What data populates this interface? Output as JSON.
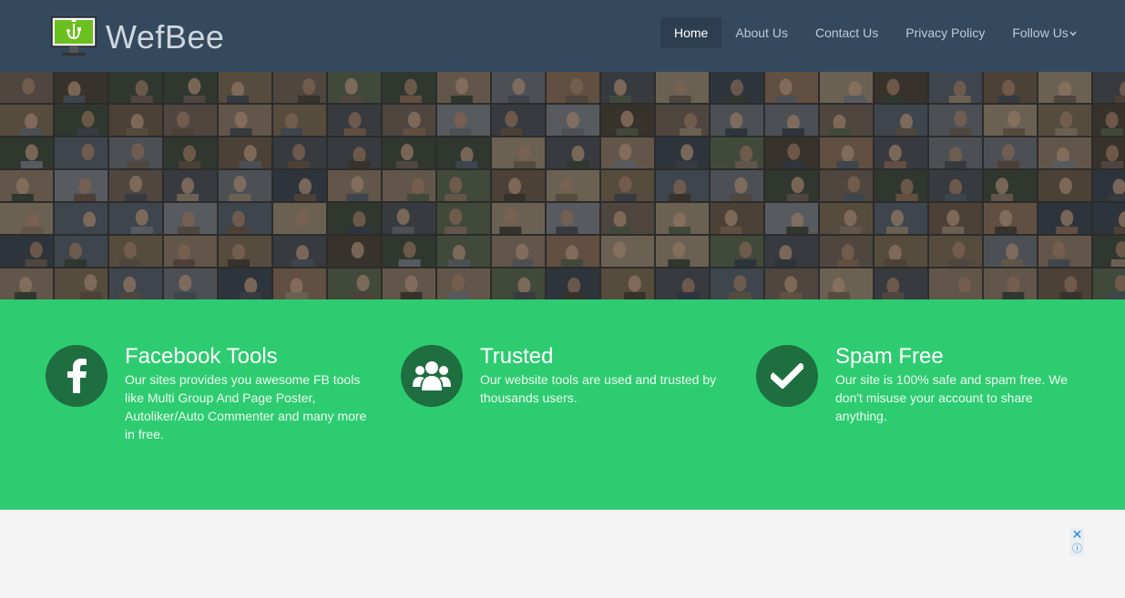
{
  "brand": {
    "name": "WefBee",
    "logo_icon": "monitor-usb-logo"
  },
  "nav": {
    "items": [
      {
        "label": "Home",
        "active": true
      },
      {
        "label": "About Us"
      },
      {
        "label": "Contact Us"
      },
      {
        "label": "Privacy Policy"
      },
      {
        "label": "Follow Us",
        "dropdown": true
      }
    ]
  },
  "hero": {
    "image": "profile-photo-collage"
  },
  "features": [
    {
      "icon": "facebook-f-icon",
      "title": "Facebook Tools",
      "text": "Our sites provides you awesome FB tools like Multi Group And Page Poster, Autoliker/Auto Commenter and many more in free."
    },
    {
      "icon": "users-icon",
      "title": "Trusted",
      "text": "Our website tools are used and trusted by thousands users."
    },
    {
      "icon": "checkmark-icon",
      "title": "Spam Free",
      "text": "Our site is 100% safe and spam free. We don't misuse your account to share anything."
    }
  ],
  "ad": {
    "close_symbol": "✕",
    "info_symbol": "ⓘ"
  },
  "colors": {
    "navbar": "#34495e",
    "features_bg": "#2ecc71",
    "icon_circle": "#1e6e40"
  }
}
